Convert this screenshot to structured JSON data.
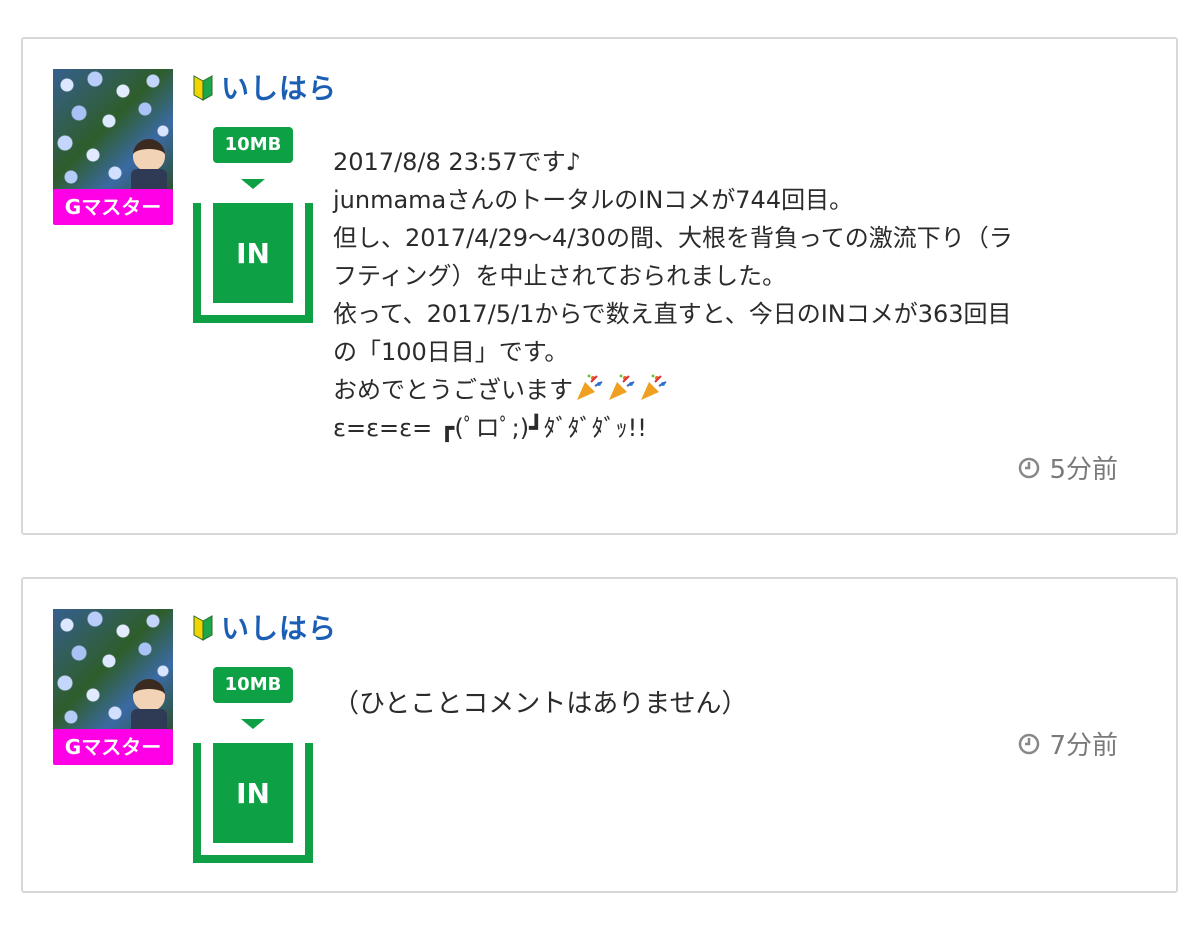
{
  "posts": [
    {
      "avatar_badge": "Gマスター",
      "username": "いしはら",
      "size_badge": "10MB",
      "in_label": "IN",
      "message_lines": [
        "2017/8/8 23:57です♪",
        "junmamaさんのトータルのINコメが744回目。",
        "但し、2017/4/29〜4/30の間、大根を背負っての激流下り（ラ",
        "フティング）を中止されておられました。",
        "依って、2017/5/1からで数え直すと、今日のINコメが363回目",
        "の「100日目」です。",
        "おめでとうございます",
        "ε=ε=ε= ┏(ﾟロﾟ;)┛ﾀﾞﾀﾞﾀﾞｯ!!"
      ],
      "celebration_icons": [
        "party-popper-icon",
        "party-popper-icon",
        "party-popper-icon"
      ],
      "timestamp": "5分前"
    },
    {
      "avatar_badge": "Gマスター",
      "username": "いしはら",
      "size_badge": "10MB",
      "in_label": "IN",
      "message": "（ひとことコメントはありません）",
      "timestamp": "7分前"
    }
  ],
  "colors": {
    "master_badge": "#ff00e6",
    "green": "#0ea044",
    "username": "#1a5fb4",
    "timestamp": "#7a7a7a"
  }
}
